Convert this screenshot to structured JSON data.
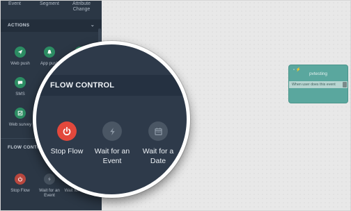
{
  "sidebar": {
    "top_items": [
      "Event",
      "Segment",
      "Attribute\nChange"
    ],
    "actions_header": "ACTIONS",
    "actions": [
      {
        "label": "Web push",
        "icon": "paper-plane-icon"
      },
      {
        "label": "App push",
        "icon": "bell-icon"
      },
      {
        "label": "SMS",
        "icon": "chat-bubble-icon"
      },
      {
        "label": "Web survey",
        "icon": "checklist-icon"
      }
    ],
    "flow_header": "FLOW CONTROL",
    "flow": [
      {
        "label": "Stop Flow",
        "icon": "power-icon"
      },
      {
        "label": "Wait for an Event",
        "icon": "bolt-icon"
      },
      {
        "label": "Wait for a Date",
        "icon": "calendar-icon"
      }
    ]
  },
  "canvas": {
    "node": {
      "title": "pvtesting",
      "body": "When user does this event"
    }
  },
  "magnifier": {
    "header": "FLOW CONTROL",
    "items": [
      {
        "label": "Stop Flow",
        "icon": "power-icon"
      },
      {
        "label": "Wait for an\nEvent",
        "icon": "bolt-icon"
      },
      {
        "label": "Wait for a\nDate",
        "icon": "calendar-icon"
      }
    ]
  },
  "colors": {
    "sidebar_bg": "#2b3745",
    "magnifier_bg": "#2e3a4a",
    "stop_red": "#e2483c",
    "action_green": "#2c8d63",
    "node_teal": "#5aa79e"
  }
}
